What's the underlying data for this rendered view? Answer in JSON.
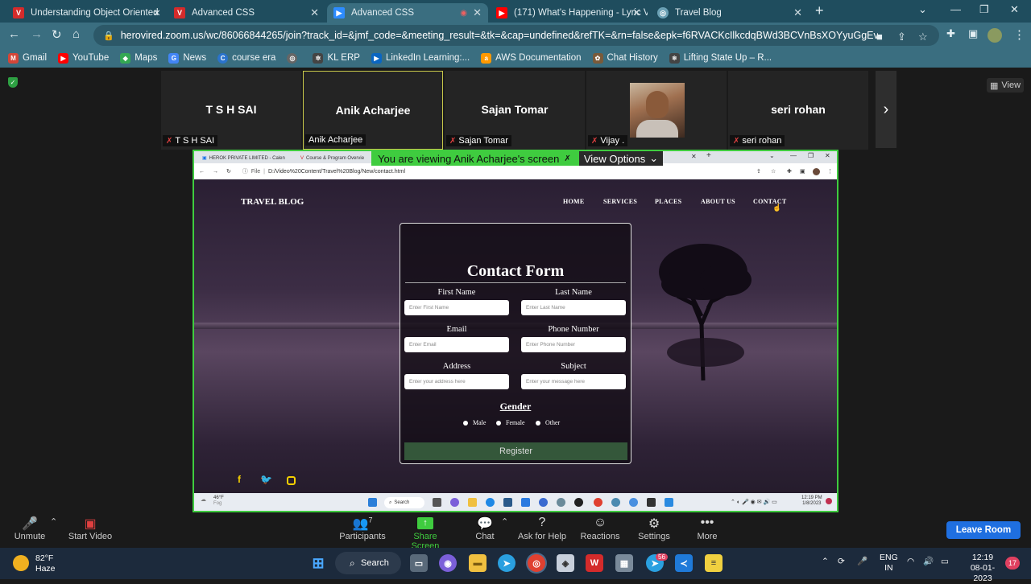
{
  "browser": {
    "tabs": [
      {
        "title": "Understanding Object Oriented",
        "icon": "v-logo-icon",
        "color": "#d42b2b"
      },
      {
        "title": "Advanced CSS",
        "icon": "v-logo-icon",
        "color": "#d42b2b"
      },
      {
        "title": "Advanced CSS",
        "icon": "zoom-icon",
        "color": "#2d8cff",
        "active": true
      },
      {
        "title": "(171) What's Happening - Lyric V",
        "icon": "youtube-icon",
        "color": "#ff0000"
      },
      {
        "title": "Travel Blog",
        "icon": "globe-icon",
        "color": "#6aa0b4"
      }
    ],
    "url": "herovired.zoom.us/wc/86066844265/join?track_id=&jmf_code=&meeting_result=&tk=&cap=undefined&refTK=&rn=false&epk=f6RVACKcIlkcdqBWd3BCVnBsXOYyuGgEvTwpMJk2...",
    "bookmarks": [
      {
        "label": "Gmail",
        "color": "#d44638"
      },
      {
        "label": "YouTube",
        "color": "#ff0000"
      },
      {
        "label": "Maps",
        "color": "#34a853"
      },
      {
        "label": "News",
        "color": "#4285f4"
      },
      {
        "label": "course era",
        "color": "#2a73cc"
      },
      {
        "label": "",
        "color": "#666666"
      },
      {
        "label": "KL ERP",
        "color": "#444444"
      },
      {
        "label": "LinkedIn Learning:...",
        "color": "#0a66c2"
      },
      {
        "label": "AWS Documentation",
        "color": "#ff9900"
      },
      {
        "label": "Chat History",
        "color": "#7a5a3a"
      },
      {
        "label": "Lifting State Up – R...",
        "color": "#444444"
      }
    ]
  },
  "zoom": {
    "view_label": "View",
    "participants": [
      {
        "name": "T S H SAI",
        "label": "T S H SAI"
      },
      {
        "name": "Anik Acharjee",
        "label": "Anik Acharjee",
        "speaking": true
      },
      {
        "name": "Sajan Tomar",
        "label": "Sajan Tomar"
      },
      {
        "name": "",
        "label": "Vijay ."
      },
      {
        "name": "seri rohan",
        "label": "seri rohan"
      }
    ],
    "banner": "You are viewing Anik Acharjee's screen",
    "view_options": "View Options",
    "controls": {
      "unmute": "Unmute",
      "start_video": "Start Video",
      "participants": "Participants",
      "participants_count": "7",
      "share_screen": "Share Screen",
      "chat": "Chat",
      "ask_for_help": "Ask for Help",
      "reactions": "Reactions",
      "settings": "Settings",
      "more": "More",
      "leave": "Leave Room"
    }
  },
  "shared": {
    "tabs": [
      "HEROK PRIVATE LIMITED - Calen",
      "Course & Program Overvie"
    ],
    "addr_prefix": "File",
    "url": "D:/Video%20Content/Travel%20Blog/New/contact.html",
    "site": {
      "brand": "TRAVEL BLOG",
      "nav": [
        "HOME",
        "SERVICES",
        "PLACES",
        "ABOUT US",
        "CONTACT"
      ],
      "form_title": "Contact Form",
      "fields": [
        {
          "label": "First Name",
          "placeholder": "Enter First Name"
        },
        {
          "label": "Last Name",
          "placeholder": "Enter Last Name"
        },
        {
          "label": "Email",
          "placeholder": "Enter Email"
        },
        {
          "label": "Phone Number",
          "placeholder": "Enter Phone Number"
        },
        {
          "label": "Address",
          "placeholder": "Enter your address here"
        },
        {
          "label": "Subject",
          "placeholder": "Enter your message here"
        }
      ],
      "gender_title": "Gender",
      "gender_options": [
        "Male",
        "Female",
        "Other"
      ],
      "register": "Register"
    },
    "taskbar": {
      "weather_temp": "46°F",
      "weather_desc": "Fog",
      "search": "Search",
      "time": "12:19 PM",
      "date": "1/8/2023"
    }
  },
  "taskbar": {
    "weather_temp": "82°F",
    "weather_desc": "Haze",
    "search": "Search",
    "lang1": "ENG",
    "lang2": "IN",
    "time": "12:19",
    "date": "08-01-2023",
    "notifications": "17",
    "badge": "56"
  }
}
